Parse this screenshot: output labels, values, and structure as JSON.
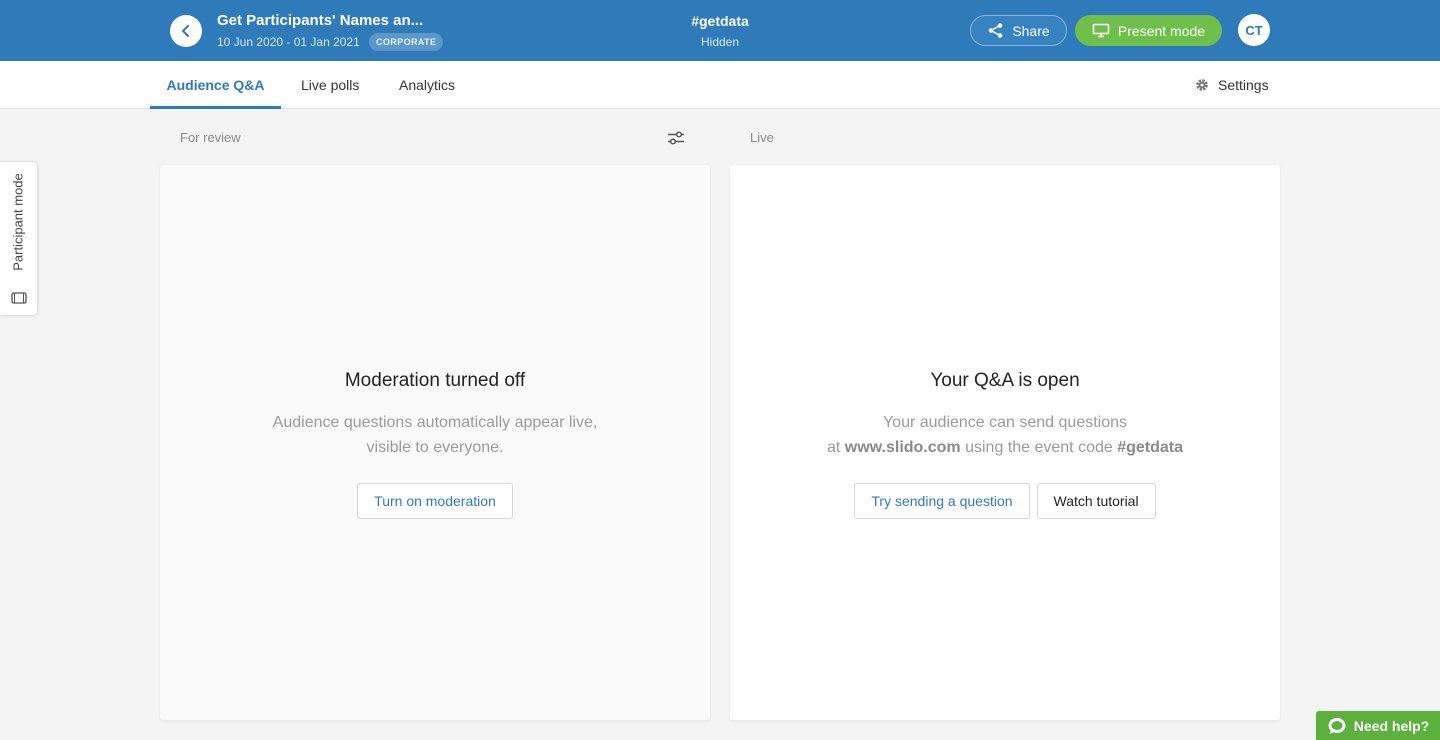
{
  "header": {
    "event_title": "Get Participants' Names an...",
    "event_dates": "10 Jun 2020 - 01 Jan 2021",
    "event_badge": "CORPORATE",
    "event_code": "#getdata",
    "event_visibility": "Hidden",
    "share_label": "Share",
    "present_label": "Present mode",
    "avatar_initials": "CT"
  },
  "tabs": [
    {
      "label": "Audience Q&A",
      "active": true
    },
    {
      "label": "Live polls",
      "active": false
    },
    {
      "label": "Analytics",
      "active": false
    }
  ],
  "settings_label": "Settings",
  "columns": {
    "review_label": "For review",
    "live_label": "Live"
  },
  "review_panel": {
    "heading": "Moderation turned off",
    "text_line1": "Audience questions automatically appear live,",
    "text_line2": "visible to everyone.",
    "button_label": "Turn on moderation"
  },
  "live_panel": {
    "heading": "Your Q&A is open",
    "text_line1": "Your audience can send questions",
    "text_at": "at ",
    "text_site": "www.slido.com",
    "text_mid": " using the event code ",
    "text_code": "#getdata",
    "button_try_label": "Try sending a question",
    "button_tutorial_label": "Watch tutorial"
  },
  "participant_mode_label": "Participant mode",
  "help_label": "Need help?",
  "colors": {
    "brand_blue": "#2f7ab8",
    "present_green": "#6fc04b",
    "help_green": "#5cb03c"
  }
}
